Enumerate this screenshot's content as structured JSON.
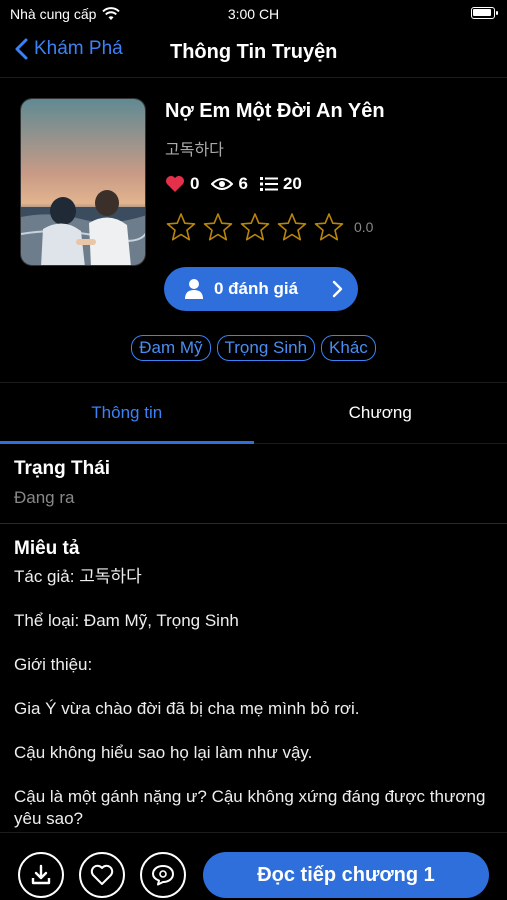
{
  "status_bar": {
    "carrier": "Nhà cung cấp",
    "time": "3:00 CH"
  },
  "nav": {
    "back_label": "Khám Phá",
    "title": "Thông Tin Truyện"
  },
  "story": {
    "title": "Nợ Em Một Đời An Yên",
    "author": "고독하다",
    "likes": "0",
    "views": "6",
    "chapters": "20",
    "rating_stars": 0,
    "rating_value": "0.0"
  },
  "review_button": {
    "label": "0 đánh giá"
  },
  "tags": [
    "Đam Mỹ",
    "Trọng Sinh",
    "Khác"
  ],
  "tabs": [
    {
      "label": "Thông tin",
      "active": true
    },
    {
      "label": "Chương",
      "active": false
    }
  ],
  "status_section": {
    "heading": "Trạng Thái",
    "value": "Đang ra"
  },
  "description": {
    "heading": "Miêu tả",
    "lines": [
      "Tác giả: 고독하다",
      "Thể loại: Đam Mỹ, Trọng Sinh",
      "Giới thiệu:",
      "Gia Ý vừa chào đời đã bị cha mẹ mình bỏ rơi.",
      "Cậu không hiểu sao họ lại làm như vậy.",
      "Cậu là một gánh nặng ư? Cậu không xứng đáng được thương yêu sao?"
    ]
  },
  "bottom_bar": {
    "read_label": "Đọc tiếp chương 1"
  },
  "colors": {
    "accent": "#2f6fdc",
    "link": "#3b82f6",
    "heart": "#e5304c",
    "star_outline": "#b8860b"
  }
}
